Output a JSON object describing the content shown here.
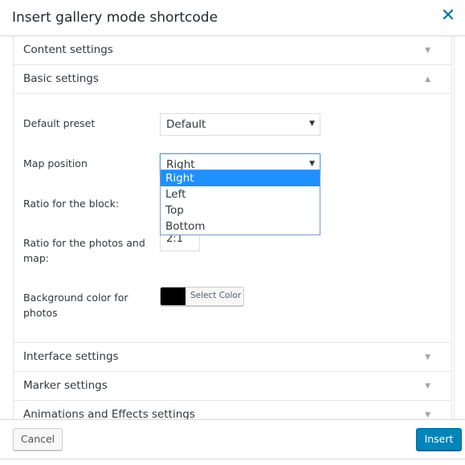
{
  "dialog": {
    "title": "Insert gallery mode shortcode",
    "close_icon": "close-x-icon"
  },
  "sections": [
    {
      "label": "Content settings",
      "state": "collapsed",
      "arrow": "▼"
    },
    {
      "label": "Basic settings",
      "state": "expanded",
      "arrow": "▲"
    },
    {
      "label": "Interface settings",
      "state": "collapsed",
      "arrow": "▼"
    },
    {
      "label": "Marker settings",
      "state": "collapsed",
      "arrow": "▼"
    },
    {
      "label": "Animations and Effects settings",
      "state": "collapsed",
      "arrow": "▼"
    }
  ],
  "basic": {
    "default_preset": {
      "label": "Default preset",
      "value": "Default",
      "caret": "▼"
    },
    "map_position": {
      "label": "Map position",
      "value": "Right",
      "caret": "▼",
      "options": [
        "Right",
        "Left",
        "Top",
        "Bottom"
      ],
      "highlighted": "Right"
    },
    "ratio_block": {
      "label": "Ratio for the block:"
    },
    "ratio_photos_map": {
      "label": "Ratio for the photos and map:",
      "value": "2:1"
    },
    "bg_color": {
      "label": "Background color for photos",
      "button_label": "Select Color",
      "color": "#000000"
    }
  },
  "footer": {
    "cancel_label": "Cancel",
    "insert_label": "Insert"
  },
  "colors": {
    "accent": "#0085ba",
    "close": "#0073aa",
    "highlight": "#1e90ff"
  }
}
